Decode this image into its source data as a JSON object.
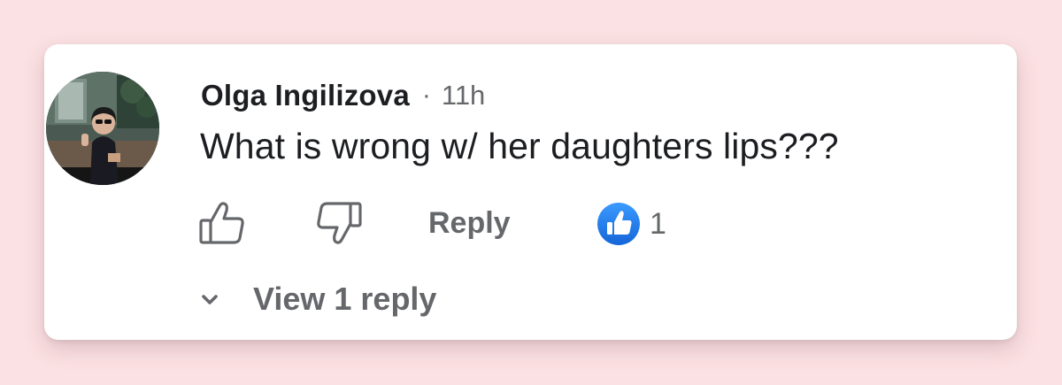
{
  "comment": {
    "author": "Olga Ingilizova",
    "separator": "·",
    "timestamp": "11h",
    "text": "What is wrong w/ her daughters lips???",
    "avatar_icon": "profile-photo-icon"
  },
  "actions": {
    "like_icon": "thumbs-up-outline-icon",
    "dislike_icon": "thumbs-down-outline-icon",
    "reply_label": "Reply",
    "reaction_icon": "like-reaction-icon",
    "reaction_count": "1"
  },
  "replies": {
    "toggle_icon": "chevron-down-icon",
    "view_label": "View 1 reply"
  },
  "colors": {
    "background": "#fbe1e3",
    "card": "#ffffff",
    "text_primary": "#1c1e21",
    "text_secondary": "#65676b",
    "reaction_blue": "#1877f2"
  }
}
